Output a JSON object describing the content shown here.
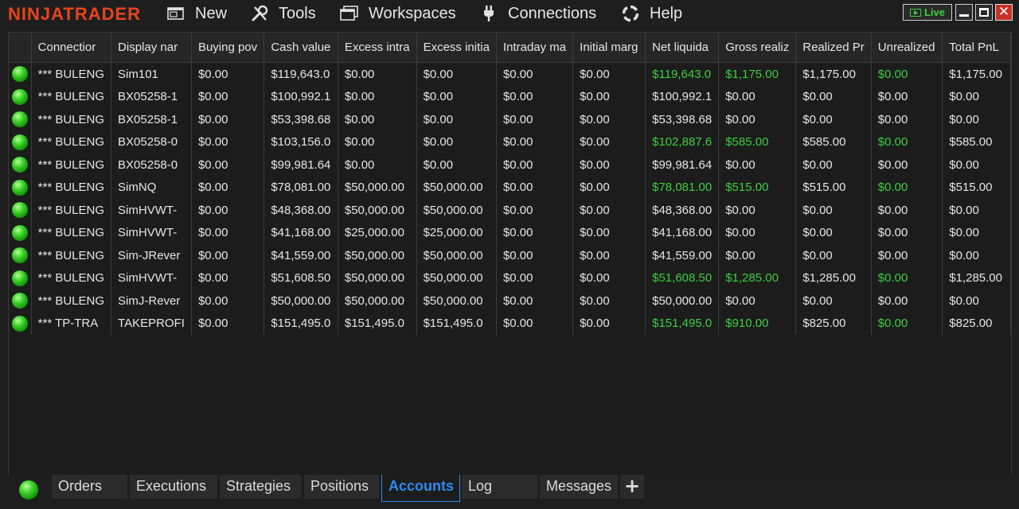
{
  "app": {
    "logo": "NINJATRADER",
    "menu": [
      {
        "label": "New",
        "icon": "new-window-icon"
      },
      {
        "label": "Tools",
        "icon": "tools-icon"
      },
      {
        "label": "Workspaces",
        "icon": "workspaces-icon"
      },
      {
        "label": "Connections",
        "icon": "plug-icon"
      },
      {
        "label": "Help",
        "icon": "help-ring-icon"
      }
    ],
    "live_label": "Live",
    "close_glyph": "✕"
  },
  "colors": {
    "brand": "#e8441c",
    "positive": "#3ccf3c",
    "active_tab": "#2a8cf0"
  },
  "grid": {
    "columns": [
      "",
      "Connection",
      "Display name",
      "Buying power",
      "Cash value",
      "Excess intraday margin",
      "Excess initial margin",
      "Intraday margin",
      "Initial margin",
      "Net liquidation",
      "Gross realized PnL",
      "Realized PnL",
      "Unrealized PnL",
      "Total PnL"
    ],
    "column_display": [
      "",
      "Connectior",
      "Display nar",
      "Buying pov",
      "Cash value",
      "Excess intra",
      "Excess initia",
      "Intraday ma",
      "Initial marg",
      "Net liquida",
      "Gross realiz",
      "Realized Pr",
      "Unrealized",
      "Total PnL"
    ],
    "rows": [
      [
        "*** BULENG",
        "Sim101",
        "$0.00",
        "$119,643.0",
        "$0.00",
        "$0.00",
        "$0.00",
        "$0.00",
        "$119,643.0",
        "$1,175.00",
        "$1,175.00",
        "$0.00",
        "$1,175.00"
      ],
      [
        "*** BULENG",
        "BX05258-1",
        "$0.00",
        "$100,992.1",
        "$0.00",
        "$0.00",
        "$0.00",
        "$0.00",
        "$100,992.1",
        "$0.00",
        "$0.00",
        "$0.00",
        "$0.00"
      ],
      [
        "*** BULENG",
        "BX05258-1",
        "$0.00",
        "$53,398.68",
        "$0.00",
        "$0.00",
        "$0.00",
        "$0.00",
        "$53,398.68",
        "$0.00",
        "$0.00",
        "$0.00",
        "$0.00"
      ],
      [
        "*** BULENG",
        "BX05258-0",
        "$0.00",
        "$103,156.0",
        "$0.00",
        "$0.00",
        "$0.00",
        "$0.00",
        "$102,887.6",
        "$585.00",
        "$585.00",
        "$0.00",
        "$585.00"
      ],
      [
        "*** BULENG",
        "BX05258-0",
        "$0.00",
        "$99,981.64",
        "$0.00",
        "$0.00",
        "$0.00",
        "$0.00",
        "$99,981.64",
        "$0.00",
        "$0.00",
        "$0.00",
        "$0.00"
      ],
      [
        "*** BULENG",
        "SimNQ",
        "$0.00",
        "$78,081.00",
        "$50,000.00",
        "$50,000.00",
        "$0.00",
        "$0.00",
        "$78,081.00",
        "$515.00",
        "$515.00",
        "$0.00",
        "$515.00"
      ],
      [
        "*** BULENG",
        "SimHVWT-",
        "$0.00",
        "$48,368.00",
        "$50,000.00",
        "$50,000.00",
        "$0.00",
        "$0.00",
        "$48,368.00",
        "$0.00",
        "$0.00",
        "$0.00",
        "$0.00"
      ],
      [
        "*** BULENG",
        "SimHVWT-",
        "$0.00",
        "$41,168.00",
        "$25,000.00",
        "$25,000.00",
        "$0.00",
        "$0.00",
        "$41,168.00",
        "$0.00",
        "$0.00",
        "$0.00",
        "$0.00"
      ],
      [
        "*** BULENG",
        "Sim-JRever",
        "$0.00",
        "$41,559.00",
        "$50,000.00",
        "$50,000.00",
        "$0.00",
        "$0.00",
        "$41,559.00",
        "$0.00",
        "$0.00",
        "$0.00",
        "$0.00"
      ],
      [
        "*** BULENG",
        "SimHVWT-",
        "$0.00",
        "$51,608.50",
        "$50,000.00",
        "$50,000.00",
        "$0.00",
        "$0.00",
        "$51,608.50",
        "$1,285.00",
        "$1,285.00",
        "$0.00",
        "$1,285.00"
      ],
      [
        "*** BULENG",
        "SimJ-Rever",
        "$0.00",
        "$50,000.00",
        "$50,000.00",
        "$50,000.00",
        "$0.00",
        "$0.00",
        "$50,000.00",
        "$0.00",
        "$0.00",
        "$0.00",
        "$0.00"
      ],
      [
        "*** TP-TRA",
        "TAKEPROFI",
        "$0.00",
        "$151,495.0",
        "$151,495.0",
        "$151,495.0",
        "$0.00",
        "$0.00",
        "$151,495.0",
        "$910.00",
        "$825.00",
        "$0.00",
        "$825.00"
      ]
    ],
    "positive_cells": [
      [
        0,
        9
      ],
      [
        0,
        10
      ],
      [
        0,
        12
      ],
      [
        3,
        9
      ],
      [
        3,
        10
      ],
      [
        3,
        12
      ],
      [
        5,
        9
      ],
      [
        5,
        10
      ],
      [
        5,
        12
      ],
      [
        9,
        9
      ],
      [
        9,
        10
      ],
      [
        9,
        12
      ],
      [
        11,
        9
      ],
      [
        11,
        10
      ],
      [
        11,
        12
      ]
    ]
  },
  "tabs": [
    {
      "label": "Orders",
      "active": false
    },
    {
      "label": "Executions",
      "active": false
    },
    {
      "label": "Strategies",
      "active": false
    },
    {
      "label": "Positions",
      "active": false
    },
    {
      "label": "Accounts",
      "active": true
    },
    {
      "label": "Log",
      "active": false
    },
    {
      "label": "Messages",
      "active": false
    }
  ],
  "add_tab_glyph": "+"
}
